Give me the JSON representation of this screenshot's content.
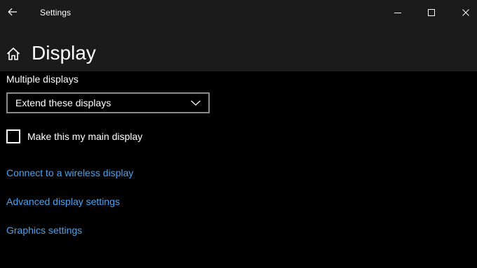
{
  "window": {
    "title": "Settings"
  },
  "header": {
    "page_title": "Display"
  },
  "multiple_displays": {
    "label": "Multiple displays",
    "dropdown_value": "Extend these displays",
    "checkbox_label": "Make this my main display",
    "checkbox_checked": false
  },
  "links": [
    {
      "label": "Connect to a wireless display"
    },
    {
      "label": "Advanced display settings"
    },
    {
      "label": "Graphics settings"
    }
  ],
  "colors": {
    "background": "#000000",
    "header_background": "#1b1b1b",
    "link": "#4aa3f0",
    "dropdown_border": "#8a8a8a"
  },
  "icons": {
    "back": "back-arrow-icon",
    "home": "home-icon",
    "minimize": "minimize-icon",
    "maximize": "maximize-icon",
    "close": "close-icon",
    "dropdown": "chevron-down-icon"
  }
}
